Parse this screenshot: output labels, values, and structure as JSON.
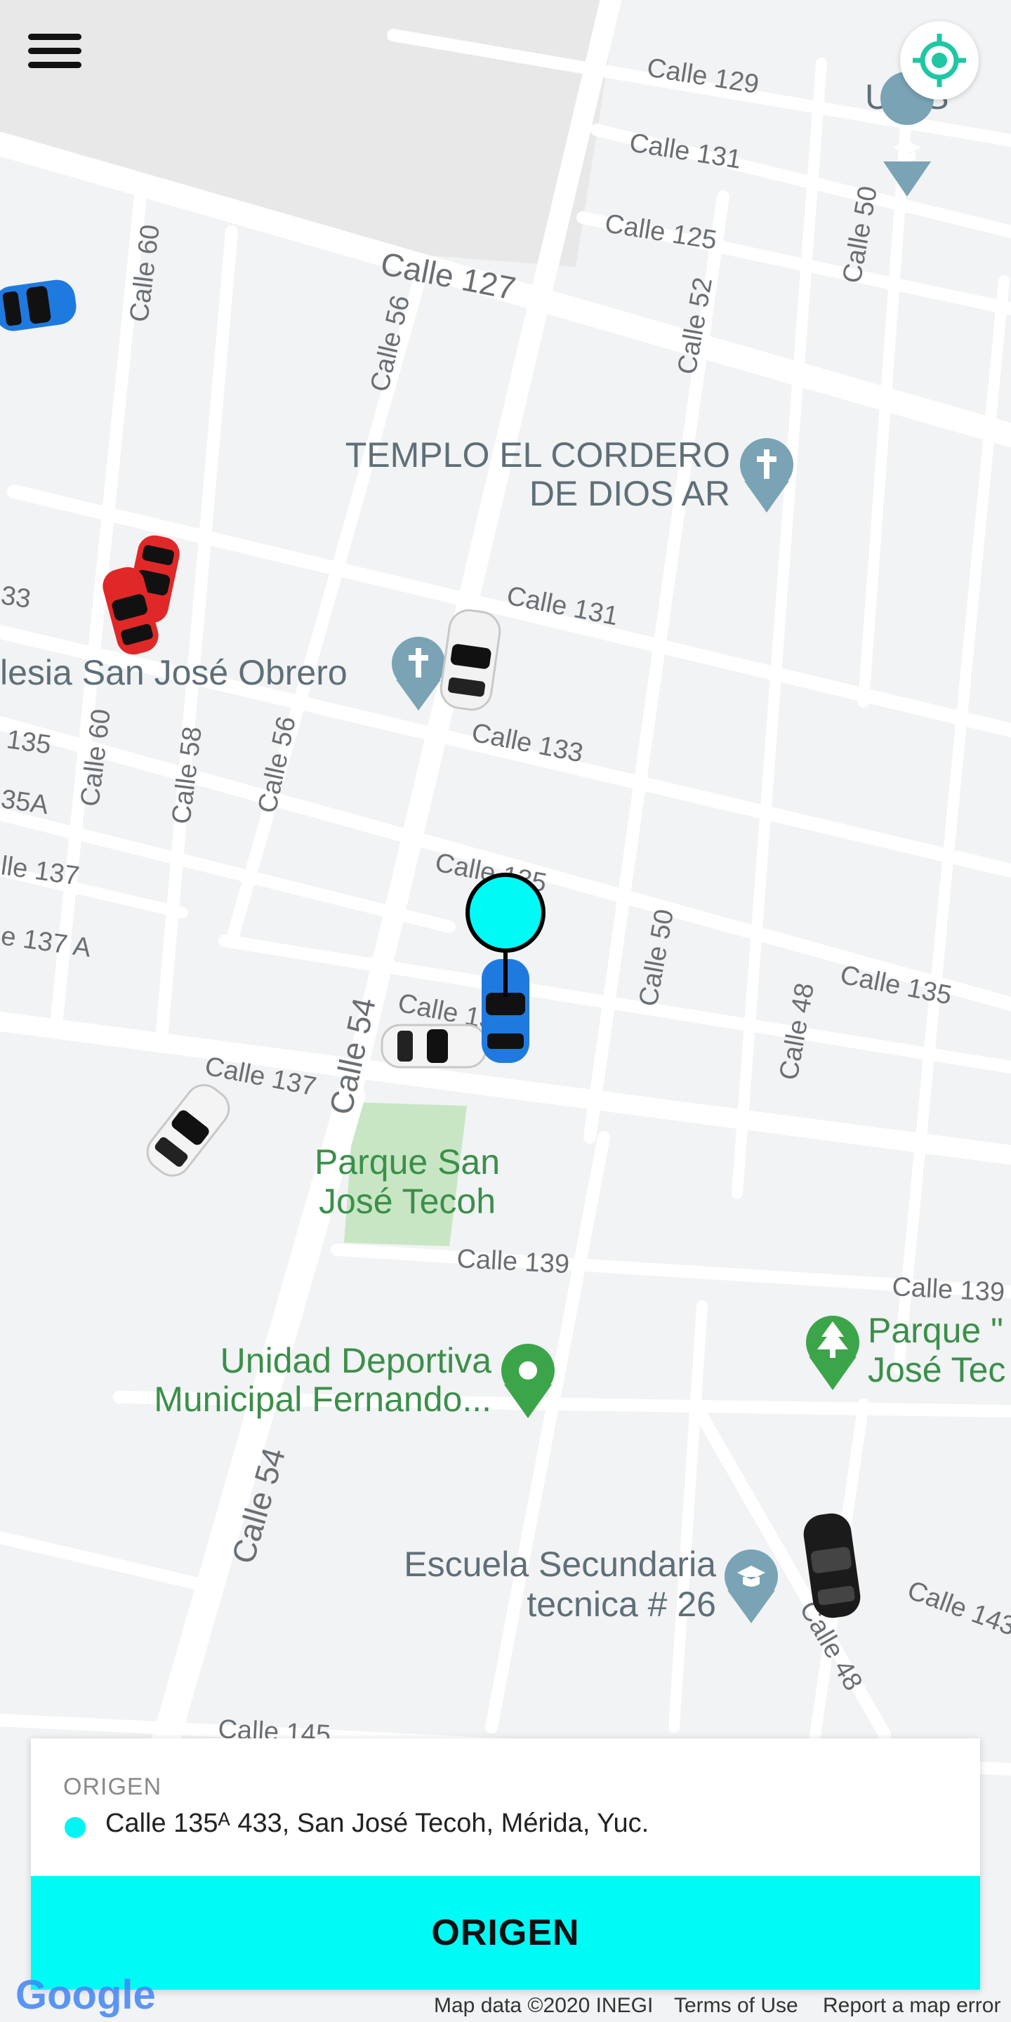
{
  "app": {
    "menu_icon": "hamburger-menu-icon",
    "locate_icon": "gps-crosshair-icon",
    "accent_color": "#00fbf7"
  },
  "map": {
    "streets": {
      "calle_129": "Calle 129",
      "calle_131_top": "Calle 131",
      "calle_125": "Calle 125",
      "calle_127": "Calle 127",
      "calle_60_top": "Calle 60",
      "calle_56_top": "Calle 56",
      "calle_52": "Calle 52",
      "calle_50_top": "Calle 50",
      "calle_131": "Calle 131",
      "calle_133": "Calle 133",
      "calle_135_left": "135",
      "calle_60": "Calle 60",
      "calle_58": "Calle 58",
      "calle_56": "Calle 56",
      "calle_35a": "35A",
      "calle_137_left": "lle 137",
      "calle_137a": "e 137 A",
      "calle_135_mid": "Calle 135",
      "calle_50": "Calle 50",
      "calle_135": "Calle 135",
      "calle_48": "Calle 48",
      "calle_54": "Calle 54",
      "calle_13": "Calle 13",
      "calle_137": "Calle 137",
      "calle_139": "Calle 139",
      "calle_139_right": "Calle 139",
      "calle_54_bottom": "Calle 54",
      "calle_143": "Calle 143",
      "calle_48_bottom": "Calle 48",
      "calle_145": "Calle 145",
      "calle_33": "33"
    },
    "pois": {
      "uuis": "UUIS",
      "templo_line1": "TEMPLO EL CORDERO",
      "templo_line2": "DE DIOS AR",
      "iglesia": "lesia San José Obrero",
      "parque_line1": "Parque San",
      "parque_line2": "José Tecoh",
      "unidad_line1": "Unidad Deportiva",
      "unidad_line2": "Municipal Fernando...",
      "parque2_line1": "Parque \"",
      "parque2_line2": "José Tec",
      "escuela_line1": "Escuela Secundaria",
      "escuela_line2": "tecnica # 26"
    },
    "pin_color": "#00fbf7",
    "attribution": {
      "logo": "Google",
      "data": "Map data ©2020 INEGI",
      "terms": "Terms of Use",
      "report": "Report a map error"
    }
  },
  "origin_card": {
    "title": "ORIGEN",
    "address": "Calle 135ᴬ 433, San José Tecoh, Mérida, Yuc.",
    "button_label": "ORIGEN"
  }
}
